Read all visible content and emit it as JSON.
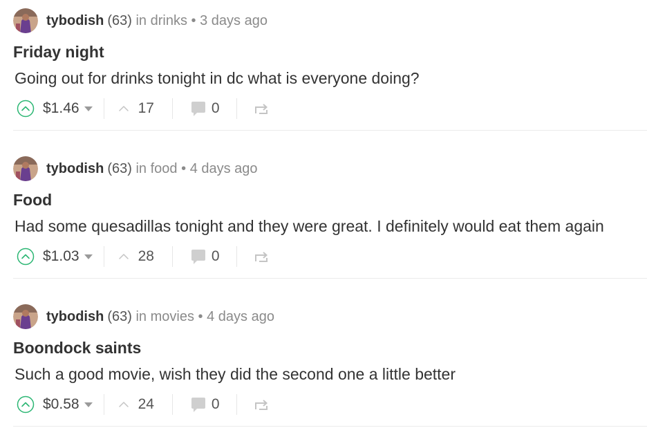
{
  "posts": [
    {
      "username": "tybodish",
      "reputation": "(63)",
      "in_text": "in",
      "category": "drinks",
      "separator": "•",
      "time": "3 days ago",
      "title": "Friday night",
      "body": "Going out for drinks tonight in dc what is everyone doing?",
      "amount": "$1.46",
      "votes": "17",
      "comments": "0"
    },
    {
      "username": "tybodish",
      "reputation": "(63)",
      "in_text": "in",
      "category": "food",
      "separator": "•",
      "time": "4 days ago",
      "title": "Food",
      "body": "Had some quesadillas tonight and they were great. I definitely would eat them again",
      "amount": "$1.03",
      "votes": "28",
      "comments": "0"
    },
    {
      "username": "tybodish",
      "reputation": "(63)",
      "in_text": "in",
      "category": "movies",
      "separator": "•",
      "time": "4 days ago",
      "title": "Boondock saints",
      "body": "Such a good movie, wish they did the second one a little better",
      "amount": "$0.58",
      "votes": "24",
      "comments": "0"
    }
  ],
  "icons": {
    "upvote": "upvote-circle-icon",
    "caret": "caret-down-icon",
    "votes": "chevron-up-icon",
    "comments": "comment-bubble-icon",
    "repost": "repost-icon"
  },
  "colors": {
    "accent_green": "#2bb673",
    "text_dark": "#333333",
    "text_muted": "#8a8a8a",
    "icon_gray": "#cccccc"
  }
}
